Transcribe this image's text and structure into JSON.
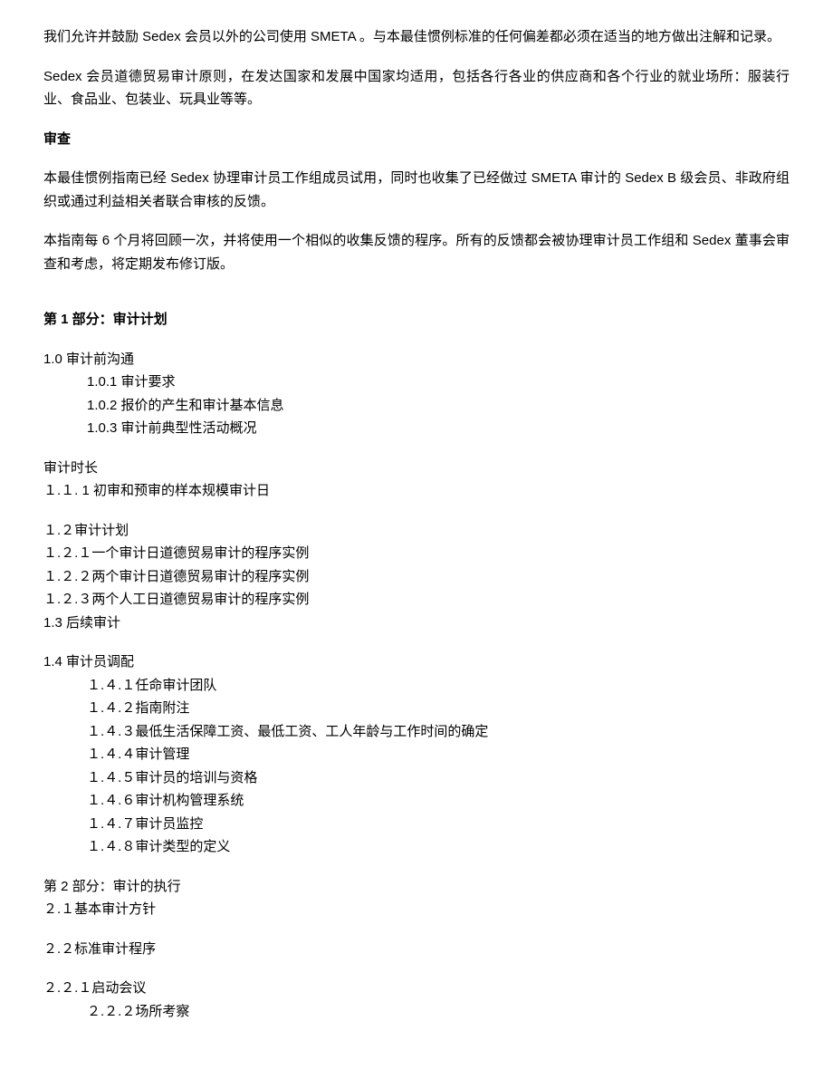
{
  "paragraphs": {
    "p1": "我们允许并鼓励 Sedex 会员以外的公司使用 SMETA 。与本最佳惯例标准的任何偏差都必须在适当的地方做出注解和记录。",
    "p2": "Sedex 会员道德贸易审计原则，在发达国家和发展中国家均适用，包括各行各业的供应商和各个行业的就业场所：服装行业、食品业、包装业、玩具业等等。",
    "h1": "审查",
    "p3": "本最佳惯例指南已经 Sedex 协理审计员工作组成员试用，同时也收集了已经做过 SMETA 审计的 Sedex B 级会员、非政府组织或通过利益相关者联合审核的反馈。",
    "p4": "本指南每 6 个月将回顾一次，并将使用一个相似的收集反馈的程序。所有的反馈都会被协理审计员工作组和 Sedex 董事会审查和考虑，将定期发布修订版。"
  },
  "part1": {
    "heading": "第 1 部分：审计计划",
    "item_1_0": "1.0 审计前沟通",
    "item_1_0_1": "1.0.1   审计要求",
    "item_1_0_2": "1.0.2   报价的产生和审计基本信息",
    "item_1_0_3": "1.0.3   审计前典型性活动概况",
    "duration_heading": "审计时长",
    "item_1_1_1": "１.１. 1 初审和预审的样本规模审计日",
    "item_1_2": "１.２审计计划",
    "item_1_2_1": "１.２.１一个审计日道德贸易审计的程序实例",
    "item_1_2_2": "１.２.２两个审计日道德贸易审计的程序实例",
    "item_1_2_3": "１.２.３两个人工日道德贸易审计的程序实例",
    "item_1_3": "1.3 后续审计",
    "item_1_4": "1.4 审计员调配",
    "item_1_4_1": "１.４.１任命审计团队",
    "item_1_4_2": "１.４.２指南附注",
    "item_1_4_3": "１.４.３最低生活保障工资、最低工资、工人年龄与工作时间的确定",
    "item_1_4_4": "１.４.４审计管理",
    "item_1_4_5": "１.４.５审计员的培训与资格",
    "item_1_4_6": "１.４.６审计机构管理系统",
    "item_1_4_7": "１.４.７审计员监控",
    "item_1_4_8": "１.４.８审计类型的定义"
  },
  "part2": {
    "heading": "第 2 部分：审计的执行",
    "item_2_1": "２.１基本审计方针",
    "item_2_2": "２.２标准审计程序",
    "item_2_2_1": "２.２.１启动会议",
    "item_2_2_2": "２.２.２场所考察"
  }
}
